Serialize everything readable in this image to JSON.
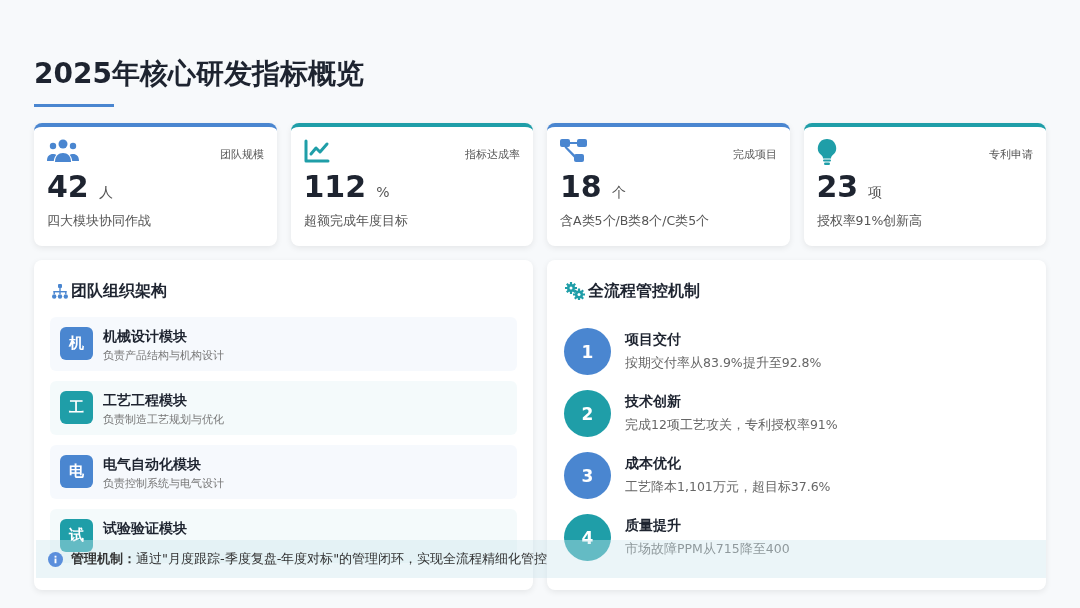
{
  "title": "2025年核心研发指标概览",
  "stats": [
    {
      "kind": "people",
      "label": "团队规模",
      "value": "42",
      "unit": "人",
      "note": "四大模块协同作战",
      "color": "#4a86d0"
    },
    {
      "kind": "chart",
      "label": "指标达成率",
      "value": "112",
      "unit": "%",
      "note": "超额完成年度目标",
      "color": "#1f9ea8"
    },
    {
      "kind": "nodes",
      "label": "完成项目",
      "value": "18",
      "unit": "个",
      "note": "含A类5个/B类8个/C类5个",
      "color": "#4a86d0"
    },
    {
      "kind": "bulb",
      "label": "专利申请",
      "value": "23",
      "unit": "项",
      "note": "授权率91%创新高",
      "color": "#1f9ea8"
    }
  ],
  "team": {
    "title": "团队组织架构",
    "modules": [
      {
        "badge": "机",
        "name": "机械设计模块",
        "desc": "负责产品结构与机构设计",
        "color": "#4a86d0"
      },
      {
        "badge": "工",
        "name": "工艺工程模块",
        "desc": "负责制造工艺规划与优化",
        "color": "#1f9ea8"
      },
      {
        "badge": "电",
        "name": "电气自动化模块",
        "desc": "负责控制系统与电气设计",
        "color": "#4a86d0"
      },
      {
        "badge": "试",
        "name": "试验验证模块",
        "color": "#1f9ea8"
      }
    ]
  },
  "process": {
    "title": "全流程管控机制",
    "steps": [
      {
        "number": "1",
        "name": "项目交付",
        "desc": "按期交付率从83.9%提升至92.8%",
        "color": "#4a86d0"
      },
      {
        "number": "2",
        "name": "技术创新",
        "desc": "完成12项工艺攻关，专利授权率91%",
        "color": "#1f9ea8"
      },
      {
        "number": "3",
        "name": "成本优化",
        "desc": "工艺降本1,101万元，超目标37.6%",
        "color": "#4a86d0"
      },
      {
        "number": "4",
        "name": "质量提升",
        "desc": "市场故障PPM从715降至400",
        "color": "#1f9ea8"
      }
    ]
  },
  "banner": {
    "text": "**管理机制：**通过\"月度跟踪-季度复盘-年度对标\"的管理闭环，实现全流程精细化管控"
  }
}
